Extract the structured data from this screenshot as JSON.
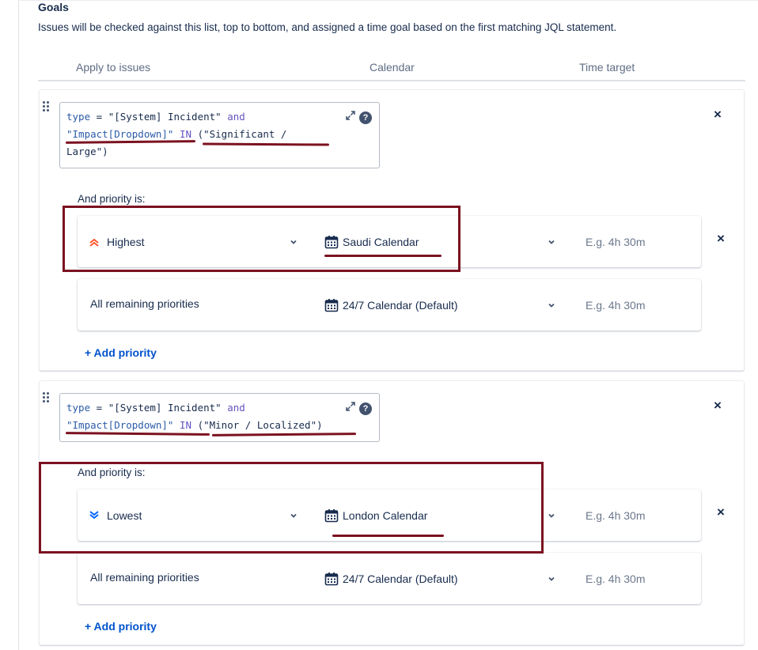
{
  "section": {
    "title": "Goals",
    "description": "Issues will be checked against this list, top to bottom, and assigned a time goal based on the first matching JQL statement."
  },
  "columns": {
    "apply": "Apply to issues",
    "calendar": "Calendar",
    "time": "Time target"
  },
  "goals": [
    {
      "jql": {
        "kw_type": "type",
        "eq": " = ",
        "str_incident": "\"[System] Incident\"",
        "kw_and": " and",
        "field": "\"Impact[Dropdown]\"",
        "kw_in": " IN ",
        "value_open": "(\"Significant /",
        "value_close": "Large\")"
      },
      "priority_label": "And priority is:",
      "rows": [
        {
          "priority": "Highest",
          "calendar": "Saudi Calendar",
          "time_placeholder": "E.g. 4h 30m"
        },
        {
          "priority": "All remaining priorities",
          "calendar": "24/7 Calendar (Default)",
          "time_placeholder": "E.g. 4h 30m"
        }
      ],
      "add_priority": "+ Add priority"
    },
    {
      "jql": {
        "kw_type": "type",
        "eq": " = ",
        "str_incident": "\"[System] Incident\"",
        "kw_and": " and",
        "field": "\"Impact[Dropdown]\"",
        "kw_in": " IN ",
        "value": "(\"Minor / Localized\")"
      },
      "priority_label": "And priority is:",
      "rows": [
        {
          "priority": "Lowest",
          "calendar": "London Calendar",
          "time_placeholder": "E.g. 4h 30m"
        },
        {
          "priority": "All remaining priorities",
          "calendar": "24/7 Calendar (Default)",
          "time_placeholder": "E.g. 4h 30m"
        }
      ],
      "add_priority": "+ Add priority"
    }
  ],
  "icons": {
    "highest": "chevron-double-up-icon",
    "lowest": "chevron-double-down-icon",
    "calendar": "calendar-icon",
    "expand": "expand-icon",
    "help": "?",
    "remove": "×",
    "drag": "drag-handle-icon"
  },
  "colors": {
    "highest": "#ff5630",
    "lowest": "#0065ff",
    "link": "#0052cc",
    "annotation": "#7b1220"
  }
}
